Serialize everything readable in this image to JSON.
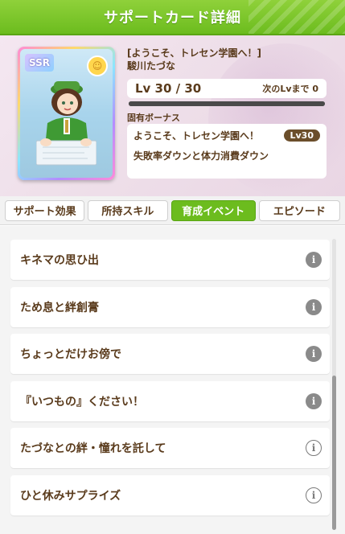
{
  "header": {
    "title": "サポートカード詳細"
  },
  "card": {
    "rarity": "SSR",
    "title": "[ようこそ、トレセン学園へ！]",
    "character": "駿川たづな",
    "level_text": "Lv 30 / 30",
    "level_current": 30,
    "level_max": 30,
    "next_level_text": "次のLvまで 0",
    "level_progress": 1.0
  },
  "unique_bonus": {
    "label": "固有ボーナス",
    "name": "ようこそ、トレセン学園へ！",
    "level_badge": "Lv30",
    "description": "失敗率ダウンと体力消費ダウン"
  },
  "tabs": [
    {
      "label": "サポート効果",
      "active": false
    },
    {
      "label": "所持スキル",
      "active": false
    },
    {
      "label": "育成イベント",
      "active": true
    },
    {
      "label": "エピソード",
      "active": false
    }
  ],
  "events": [
    {
      "label": "キネマの思ひ出"
    },
    {
      "label": "ため息と絆創膏"
    },
    {
      "label": "ちょっとだけお傍で"
    },
    {
      "label": "『いつもの』ください！"
    },
    {
      "label": "たづなとの絆・憧れを託して"
    },
    {
      "label": "ひと休みサプライズ"
    }
  ],
  "icons": {
    "info": "i",
    "medal": "☺"
  },
  "colors": {
    "accent_green": "#6cbc1e",
    "text_brown": "#5a3b1c"
  }
}
